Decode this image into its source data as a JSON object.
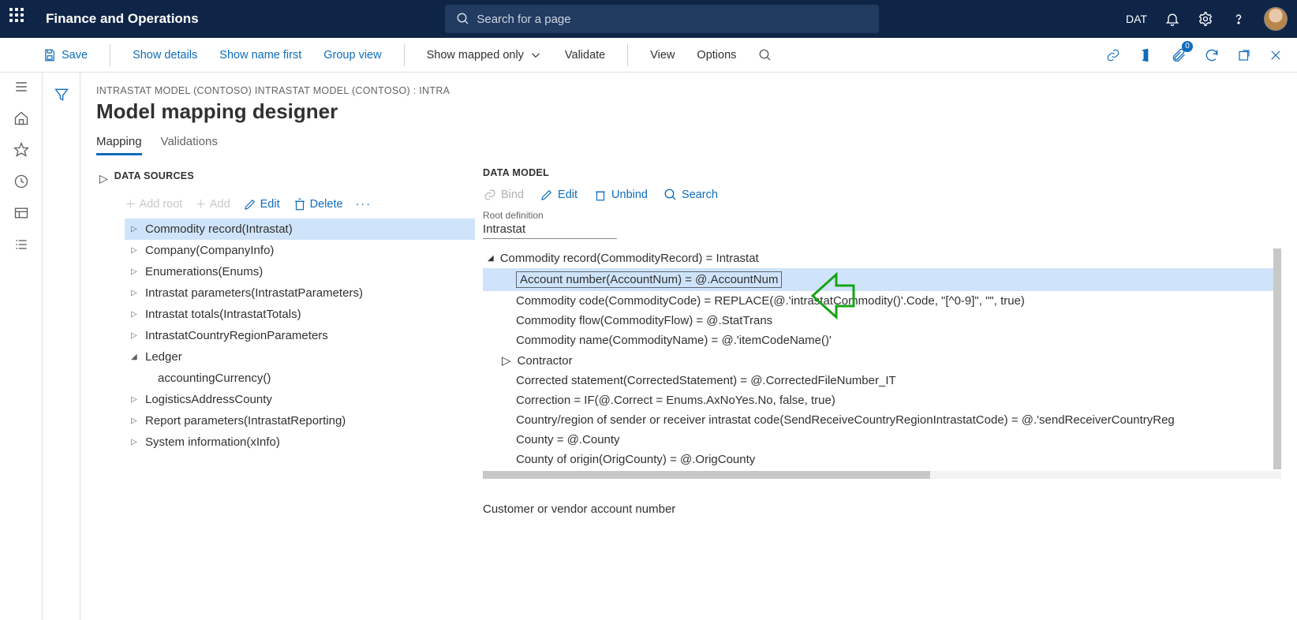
{
  "header": {
    "app_title": "Finance and Operations",
    "search_placeholder": "Search for a page",
    "company": "DAT"
  },
  "actionbar": {
    "save": "Save",
    "show_details": "Show details",
    "show_name_first": "Show name first",
    "group_view": "Group view",
    "show_mapped_only": "Show mapped only",
    "validate": "Validate",
    "view": "View",
    "options": "Options",
    "badge_count": "0"
  },
  "breadcrumb": "INTRASTAT MODEL (CONTOSO) INTRASTAT MODEL (CONTOSO) : INTRA",
  "page_title": "Model mapping designer",
  "tabs": {
    "mapping": "Mapping",
    "validations": "Validations"
  },
  "data_sources": {
    "label": "DATA SOURCES",
    "toolbar": {
      "add_root": "Add root",
      "add": "Add",
      "edit": "Edit",
      "delete": "Delete"
    },
    "items": [
      {
        "label": "Commodity record(Intrastat)",
        "expandable": true,
        "selected": true
      },
      {
        "label": "Company(CompanyInfo)",
        "expandable": true
      },
      {
        "label": "Enumerations(Enums)",
        "expandable": true
      },
      {
        "label": "Intrastat parameters(IntrastatParameters)",
        "expandable": true
      },
      {
        "label": "Intrastat totals(IntrastatTotals)",
        "expandable": true
      },
      {
        "label": "IntrastatCountryRegionParameters",
        "expandable": true
      },
      {
        "label": "Ledger",
        "expandable": true,
        "expanded": true,
        "children": [
          {
            "label": "accountingCurrency()"
          }
        ]
      },
      {
        "label": "LogisticsAddressCounty",
        "expandable": true
      },
      {
        "label": "Report parameters(IntrastatReporting)",
        "expandable": true
      },
      {
        "label": "System information(xInfo)",
        "expandable": true
      }
    ]
  },
  "data_model": {
    "label": "DATA MODEL",
    "toolbar": {
      "bind": "Bind",
      "edit": "Edit",
      "unbind": "Unbind",
      "search": "Search"
    },
    "root_def_label": "Root definition",
    "root_def_value": "Intrastat",
    "root_node": "Commodity record(CommodityRecord) = Intrastat",
    "items": [
      {
        "label": "Account number(AccountNum) = @.AccountNum",
        "selected": true
      },
      {
        "label": "Commodity code(CommodityCode) = REPLACE(@.'intrastatCommodity()'.Code, \"[^0-9]\", \"\", true)"
      },
      {
        "label": "Commodity flow(CommodityFlow) = @.StatTrans"
      },
      {
        "label": "Commodity name(CommodityName) = @.'itemCodeName()'"
      },
      {
        "label": "Contractor",
        "expandable": true
      },
      {
        "label": "Corrected statement(CorrectedStatement) = @.CorrectedFileNumber_IT"
      },
      {
        "label": "Correction = IF(@.Correct = Enums.AxNoYes.No, false, true)"
      },
      {
        "label": "Country/region of sender or receiver intrastat code(SendReceiveCountryRegionIntrastatCode) = @.'sendReceiverCountryReg"
      },
      {
        "label": "County = @.County"
      },
      {
        "label": "County of origin(OrigCounty) = @.OrigCounty"
      }
    ],
    "footer": "Customer or vendor account number"
  }
}
